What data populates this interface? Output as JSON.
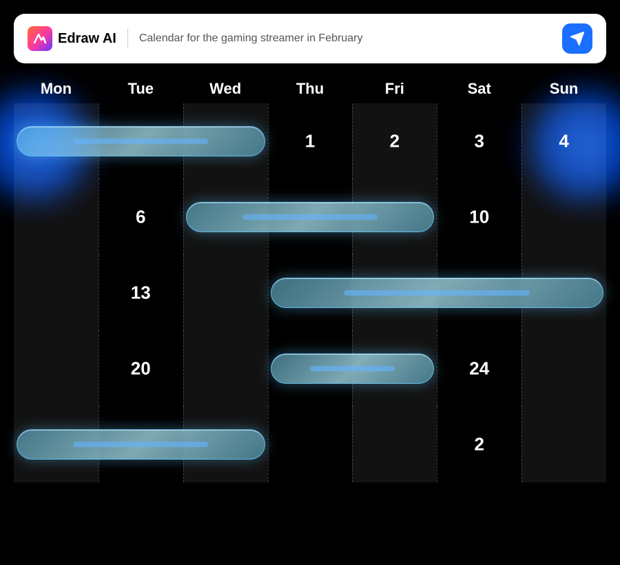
{
  "header": {
    "logo_text": "Edraw AI",
    "logo_initial": "M",
    "title": "Calendar for the gaming streamer in February",
    "send_label": "send"
  },
  "calendar": {
    "days": [
      {
        "label": "Mon"
      },
      {
        "label": "Tue"
      },
      {
        "label": "Wed"
      },
      {
        "label": "Thu"
      },
      {
        "label": "Fri"
      },
      {
        "label": "Sat"
      },
      {
        "label": "Sun"
      }
    ],
    "rows": [
      {
        "cells": [
          {
            "date": "",
            "col": 0
          },
          {
            "date": "",
            "col": 1
          },
          {
            "date": "",
            "col": 2
          },
          {
            "date": "1",
            "col": 3
          },
          {
            "date": "2",
            "col": 4
          },
          {
            "date": "3",
            "col": 5
          },
          {
            "date": "4",
            "col": 6
          }
        ],
        "bar": {
          "startCol": 0,
          "spanCols": 3,
          "id": "bar1"
        }
      },
      {
        "cells": [
          {
            "date": "",
            "col": 0
          },
          {
            "date": "6",
            "col": 1
          },
          {
            "date": "",
            "col": 2
          },
          {
            "date": "",
            "col": 3
          },
          {
            "date": "",
            "col": 4
          },
          {
            "date": "10",
            "col": 5
          },
          {
            "date": "",
            "col": 6
          }
        ],
        "bar": {
          "startCol": 2,
          "spanCols": 3,
          "id": "bar2"
        }
      },
      {
        "cells": [
          {
            "date": "",
            "col": 0
          },
          {
            "date": "13",
            "col": 1
          },
          {
            "date": "",
            "col": 2
          },
          {
            "date": "",
            "col": 3
          },
          {
            "date": "",
            "col": 4
          },
          {
            "date": "",
            "col": 5
          },
          {
            "date": "",
            "col": 6
          }
        ],
        "bar": {
          "startCol": 3,
          "spanCols": 4,
          "id": "bar3"
        }
      },
      {
        "cells": [
          {
            "date": "",
            "col": 0
          },
          {
            "date": "20",
            "col": 1
          },
          {
            "date": "",
            "col": 2
          },
          {
            "date": "",
            "col": 3
          },
          {
            "date": "",
            "col": 4
          },
          {
            "date": "24",
            "col": 5
          },
          {
            "date": "",
            "col": 6
          }
        ],
        "bar": {
          "startCol": 3,
          "spanCols": 2,
          "id": "bar4"
        }
      },
      {
        "cells": [
          {
            "date": "",
            "col": 0
          },
          {
            "date": "",
            "col": 1
          },
          {
            "date": "",
            "col": 2
          },
          {
            "date": "",
            "col": 3
          },
          {
            "date": "",
            "col": 4
          },
          {
            "date": "2",
            "col": 5
          },
          {
            "date": "",
            "col": 6
          }
        ],
        "bar": {
          "startCol": 0,
          "spanCols": 3,
          "id": "bar5"
        }
      }
    ]
  }
}
